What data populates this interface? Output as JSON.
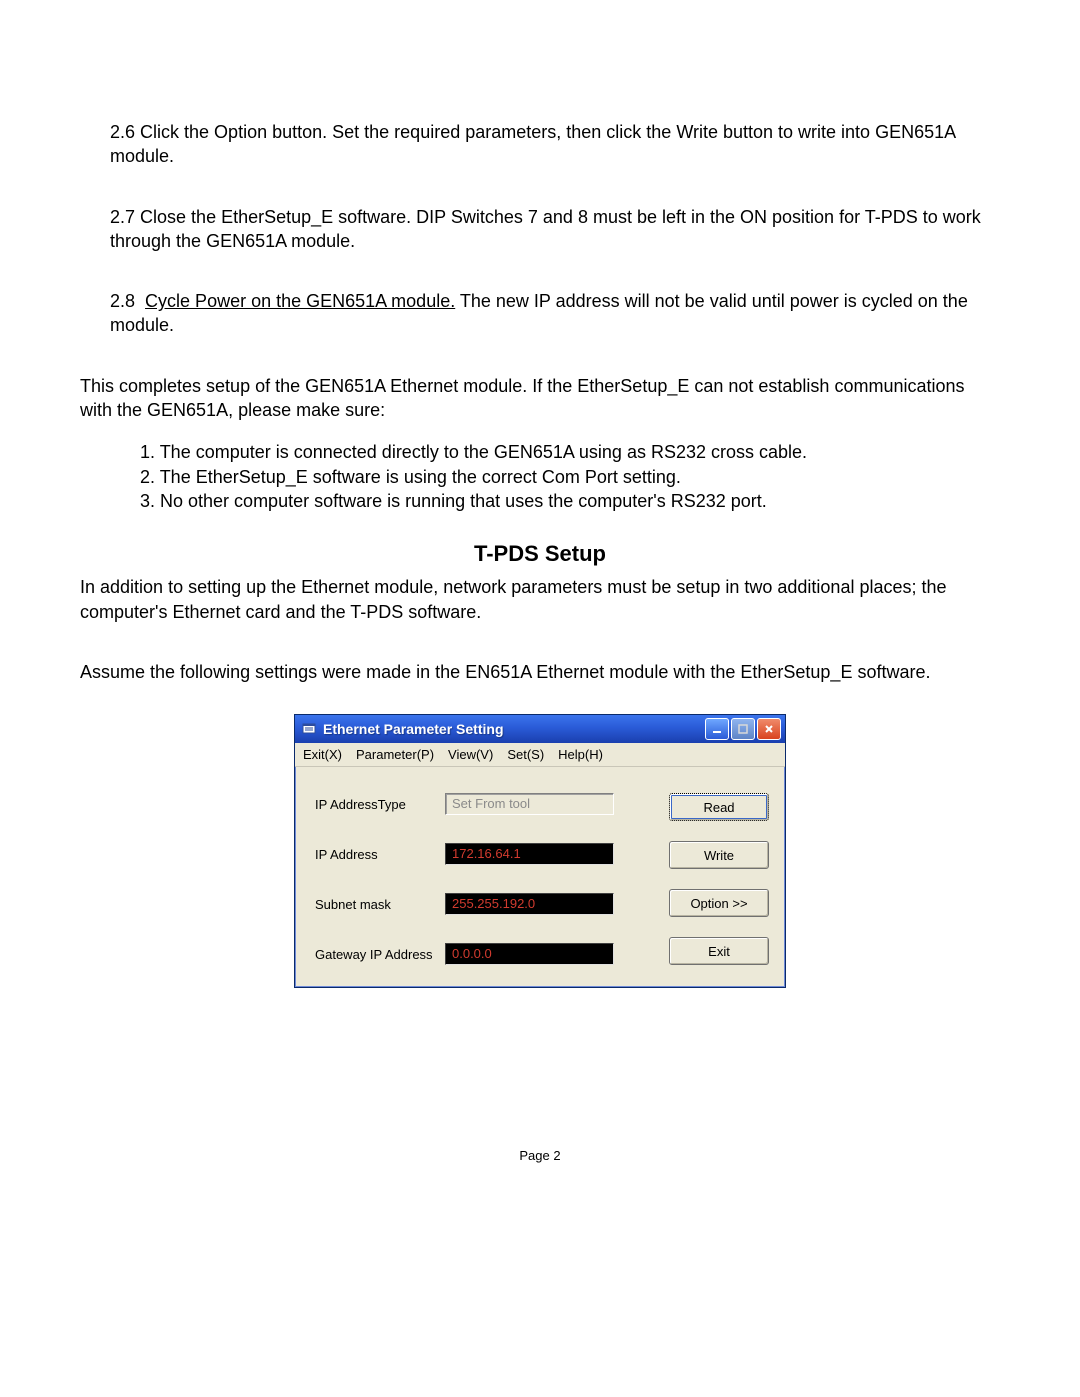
{
  "doc": {
    "p26_prefix": "2.6",
    "p26": "  Click the Option button.  Set the required parameters, then click the Write button to write into GEN651A module.",
    "p27_prefix": "2.7",
    "p27": "  Close the EtherSetup_E software.  DIP Switches 7 and 8 must be left in the ON position for T-PDS to work through the GEN651A module.",
    "p28_prefix": "2.8",
    "p28_underlined": "Cycle Power on the GEN651A module.",
    "p28_rest": "  The new IP address will not be valid until power is cycled on the module.",
    "completes": "This completes setup of the GEN651A Ethernet module.  If the EtherSetup_E can not establish communications with the GEN651A, please make sure:",
    "check1": "1.  The computer is connected directly to the GEN651A using as RS232 cross cable.",
    "check2": "2.  The EtherSetup_E software is using the correct Com Port setting.",
    "check3": "3.  No other computer software is running that uses the computer's RS232 port.",
    "heading": "T-PDS Setup",
    "intro": "   In addition to setting up the Ethernet module, network parameters must be setup in two additional places; the computer's Ethernet card and the T-PDS software.",
    "assume": "Assume the following settings were made in the EN651A Ethernet module with the EtherSetup_E software.",
    "page_label": "Page ",
    "page_no": "2"
  },
  "dialog": {
    "title": "Ethernet Parameter Setting",
    "menu": {
      "exit": "Exit(X)",
      "parameter": "Parameter(P)",
      "view": "View(V)",
      "set": "Set(S)",
      "help": "Help(H)"
    },
    "labels": {
      "ip_type": "IP AddressType",
      "ip_addr": "IP Address",
      "subnet": "Subnet mask",
      "gateway": "Gateway IP Address"
    },
    "values": {
      "ip_type": "Set From tool",
      "ip_addr": "172.16.64.1",
      "subnet": "255.255.192.0",
      "gateway": "0.0.0.0"
    },
    "buttons": {
      "read": "Read",
      "write": "Write",
      "option": "Option >>",
      "exit": "Exit"
    }
  }
}
